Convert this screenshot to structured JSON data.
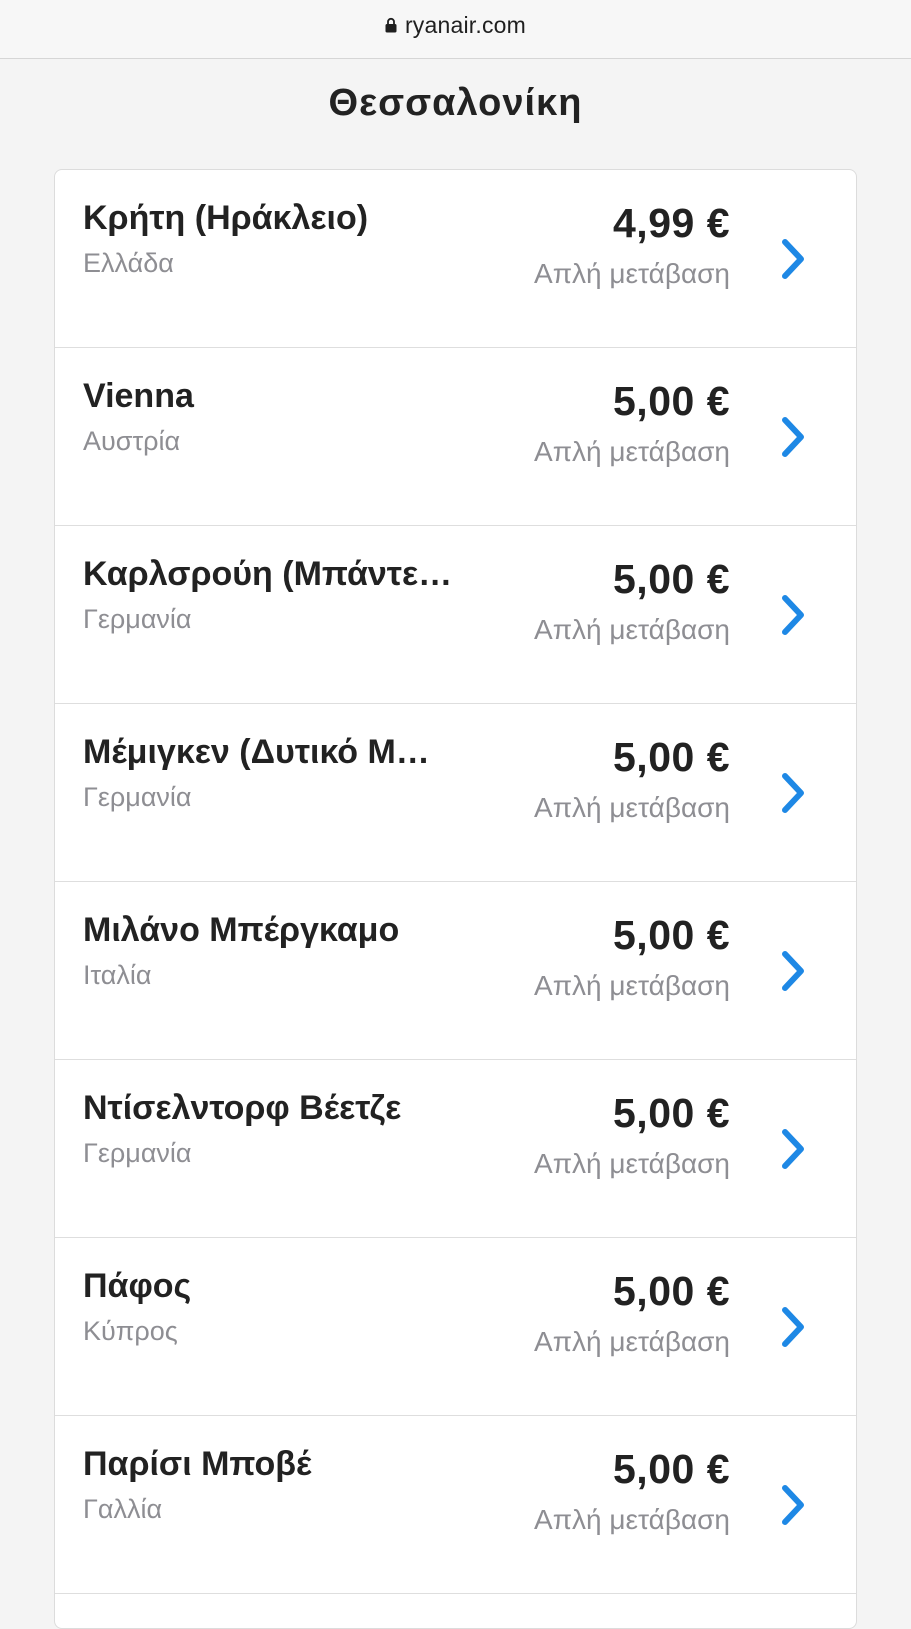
{
  "browser": {
    "domain": "ryanair.com",
    "lock_icon": "lock-icon"
  },
  "page": {
    "title": "Θεσσαλονίκη"
  },
  "colors": {
    "accent": "#1e88e5",
    "muted_text": "#8e8e93",
    "primary_text": "#222222"
  },
  "destinations": [
    {
      "name": "Κρήτη (Ηράκλειο)",
      "country": "Ελλάδα",
      "price": "4,99 €",
      "trip": "Απλή μετάβαση",
      "icon": "chevron-right-icon"
    },
    {
      "name": "Vienna",
      "country": "Αυστρία",
      "price": "5,00 €",
      "trip": "Απλή μετάβαση",
      "icon": "chevron-right-icon"
    },
    {
      "name": "Καρλσρούη (Μπάντε…",
      "country": "Γερμανία",
      "price": "5,00 €",
      "trip": "Απλή μετάβαση",
      "icon": "chevron-right-icon"
    },
    {
      "name": "Μέμιγκεν (Δυτικό Μ…",
      "country": "Γερμανία",
      "price": "5,00 €",
      "trip": "Απλή μετάβαση",
      "icon": "chevron-right-icon"
    },
    {
      "name": "Μιλάνο Μπέργκαμο",
      "country": "Ιταλία",
      "price": "5,00 €",
      "trip": "Απλή μετάβαση",
      "icon": "chevron-right-icon"
    },
    {
      "name": "Ντίσελντορφ Βέετζε",
      "country": "Γερμανία",
      "price": "5,00 €",
      "trip": "Απλή μετάβαση",
      "icon": "chevron-right-icon"
    },
    {
      "name": "Πάφος",
      "country": "Κύπρος",
      "price": "5,00 €",
      "trip": "Απλή μετάβαση",
      "icon": "chevron-right-icon"
    },
    {
      "name": "Παρίσι Μποβέ",
      "country": "Γαλλία",
      "price": "5,00 €",
      "trip": "Απλή μετάβαση",
      "icon": "chevron-right-icon"
    }
  ]
}
